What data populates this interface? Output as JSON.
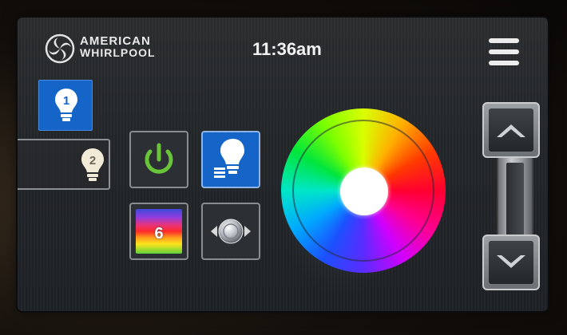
{
  "header": {
    "brand_line1": "AMERICAN",
    "brand_line2": "WHIRLPOOL",
    "time": "11:36am",
    "menu_icon": "hamburger-menu-icon"
  },
  "lights": {
    "tabs": [
      {
        "number": "1",
        "icon": "light-bulb-icon",
        "selected": true
      },
      {
        "number": "2",
        "icon": "light-bulb-icon",
        "selected": false
      }
    ]
  },
  "controls": {
    "power_icon": "power-icon",
    "mode_icon": "light-mode-icon",
    "color_number": "6",
    "move_icon": "spotlight-move-icon"
  },
  "colors": {
    "accent_blue": "#1565c8",
    "power_green": "#6ac43a",
    "wheel_center": "#ffffff"
  }
}
